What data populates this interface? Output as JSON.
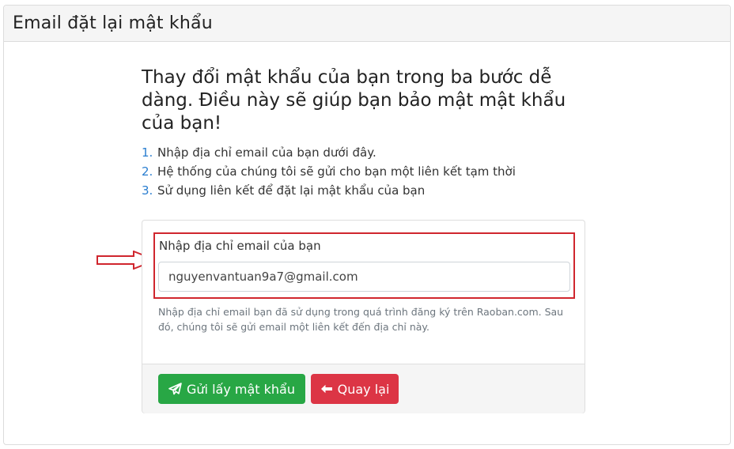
{
  "header": {
    "title": "Email đặt lại mật khẩu"
  },
  "intro": {
    "title": "Thay đổi mật khẩu của bạn trong ba bước dễ dàng. Điều này sẽ giúp bạn bảo mật mật khẩu của bạn!",
    "steps": [
      {
        "num": "1.",
        "text": "Nhập địa chỉ email của bạn dưới đây."
      },
      {
        "num": "2.",
        "text": "Hệ thống của chúng tôi sẽ gửi cho bạn một liên kết tạm thời"
      },
      {
        "num": "3.",
        "text": "Sử dụng liên kết để đặt lại mật khẩu của bạn"
      }
    ]
  },
  "form": {
    "email_label": "Nhập địa chỉ email của bạn",
    "email_value": "nguyenvantuan9a7@gmail.com",
    "help_text": "Nhập địa chỉ email bạn đã sử dụng trong quá trình đăng ký trên Raoban.com. Sau đó, chúng tôi sẽ gửi email một liên kết đến địa chỉ này.",
    "submit_label": "Gửi lấy mật khẩu",
    "back_label": "Quay lại"
  },
  "icons": {
    "submit": "paper-plane-icon",
    "back": "arrow-left-icon",
    "annotation": "red-outline-arrow"
  },
  "colors": {
    "success": "#28a745",
    "danger": "#dc3545",
    "highlight": "#d0262e",
    "step_number": "#2a7ed0"
  }
}
